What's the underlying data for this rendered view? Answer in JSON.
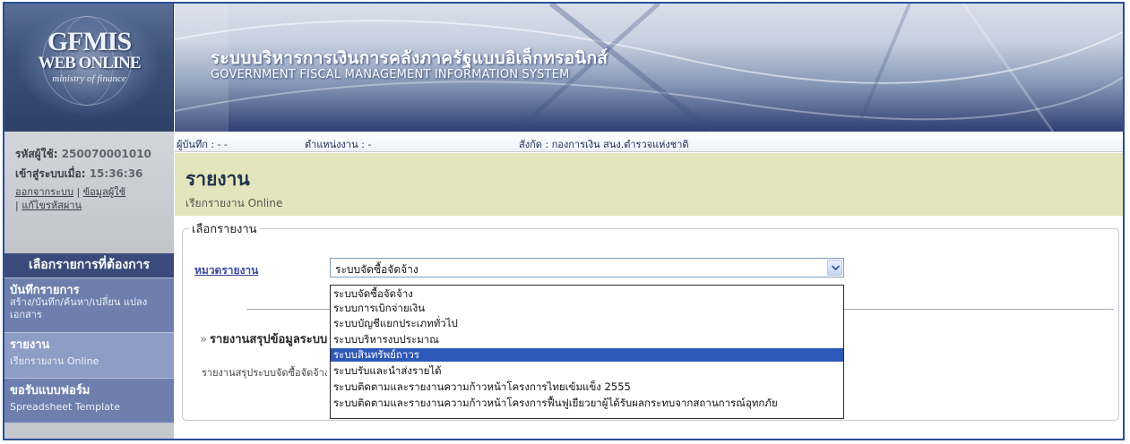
{
  "logo": {
    "line1": "GFMIS",
    "line2": "WEB ONLINE",
    "line3": "ministry of finance"
  },
  "banner": {
    "title_thai": "ระบบบริหารการเงินการคลังภาครัฐแบบอิเล็กทรอนิกส์",
    "title_eng": "GOVERNMENT FISCAL MANAGEMENT INFORMATION SYSTEM"
  },
  "info": {
    "recorder": "ผู้บันทึก : - -",
    "position": "ตำแหน่งงาน : -",
    "affiliation": "สังกัด : กองการเงิน สนง.ตำรวจแห่งชาติ"
  },
  "user": {
    "id_label": "รหัสผู้ใช้:",
    "id_value": "250070001010",
    "login_label": "เข้าสู่ระบบเมื่อ:",
    "login_value": "15:36:36",
    "logout": "ออกจากระบบ",
    "user_info": "ข้อมูลผู้ใช้",
    "change_password": "แก้ไขรหัสผ่าน",
    "sep": "|"
  },
  "menu": {
    "header": "เลือกรายการที่ต้องการ",
    "items": [
      {
        "title": "บันทึกรายการ",
        "sub": "สร้าง/บันทึก/ค้นหา/เปลี่ยน แปลง เอกสาร"
      },
      {
        "title": "รายงาน",
        "sub": "เรียกรายงาน Online"
      },
      {
        "title": "ขอรับแบบฟอร์ม",
        "sub": "Spreadsheet Template"
      }
    ]
  },
  "page": {
    "title": "รายงาน",
    "subtitle": "เรียกรายงาน Online",
    "legend": "เลือกรายงาน",
    "category_label": "หมวดรายงาน",
    "selected_value": "ระบบจัดซื้อจัดจ้าง",
    "report_heading": "รายงานสรุปข้อมูลระบบ",
    "report_bullet": "»",
    "report_row": "รายงานสรุประบบจัดซื้อจัดจ้าง"
  },
  "dropdown": {
    "selected_index": 4,
    "options": [
      "ระบบจัดซื้อจัดจ้าง",
      "ระบบการเบิกจ่ายเงิน",
      "ระบบบัญชีแยกประเภททั่วไป",
      "ระบบบริหารงบประมาณ",
      "ระบบสินทรัพย์ถาวร",
      "ระบบรับและนำส่งรายได้",
      "ระบบติดตามและรายงานความก้าวหน้าโครงการไทยเข้มแข็ง 2555",
      "ระบบติดตามและรายงานความก้าวหน้าโครงการฟื้นฟูเยียวยาผู้ได้รับผลกระทบจากสถานการณ์อุทกภัย"
    ]
  },
  "colors": {
    "border": "#2a4f9a",
    "menu_header": "#3a4a7a",
    "menu_item": "#6e7fae",
    "menu_active": "#8e9dc6",
    "page_head": "#e3e6bc",
    "selection": "#2f59b8"
  }
}
